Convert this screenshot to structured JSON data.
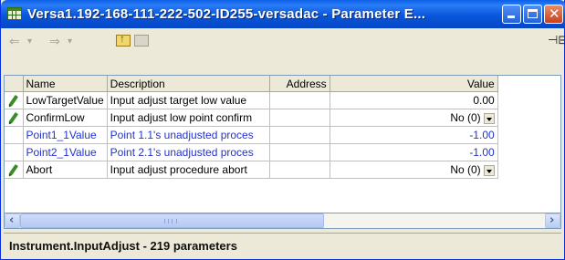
{
  "window": {
    "title": "Versa1.192-168-111-222-502-ID255-versadac - Parameter E...",
    "icon": "spreadsheet-grid-icon"
  },
  "toolbar": {
    "back_glyph": "⇐",
    "forward_glyph": "⇒",
    "dropdown_glyph": "▾"
  },
  "table": {
    "columns": [
      "",
      "Name",
      "Description",
      "Address",
      "Value"
    ],
    "rows": [
      {
        "icon": "pencil-icon",
        "name": "LowTargetValue",
        "description": "Input adjust target low value",
        "address": "",
        "value": "0.00",
        "dropdown": false,
        "style": "normal"
      },
      {
        "icon": "pencil-icon",
        "name": "ConfirmLow",
        "description": "Input adjust low point confirm",
        "address": "",
        "value": "No (0)",
        "dropdown": true,
        "style": "normal"
      },
      {
        "icon": "",
        "name": "Point1_1Value",
        "description": "Point 1.1's unadjusted proces",
        "address": "",
        "value": "-1.00",
        "dropdown": false,
        "style": "blue"
      },
      {
        "icon": "",
        "name": "Point2_1Value",
        "description": "Point 2.1's unadjusted proces",
        "address": "",
        "value": "-1.00",
        "dropdown": false,
        "style": "blue"
      },
      {
        "icon": "pencil-icon",
        "name": "Abort",
        "description": "Input adjust procedure abort",
        "address": "",
        "value": "No (0)",
        "dropdown": true,
        "style": "normal"
      }
    ]
  },
  "status": {
    "text": "Instrument.InputAdjust  -  219 parameters"
  },
  "colors": {
    "titlebar": "#0857dc",
    "link_row_text": "#2233cc",
    "pencil": "#3c8c2a"
  }
}
